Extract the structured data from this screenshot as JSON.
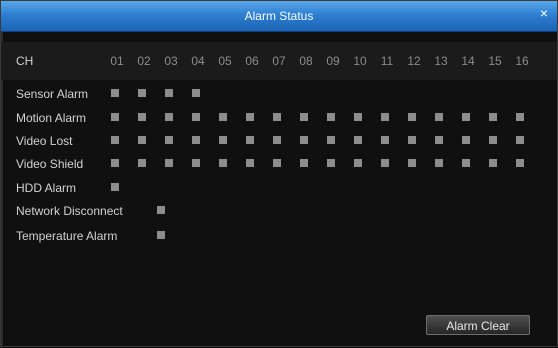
{
  "window": {
    "title": "Alarm Status",
    "close_glyph": "×"
  },
  "header": {
    "label": "CH",
    "channels": [
      "01",
      "02",
      "03",
      "04",
      "05",
      "06",
      "07",
      "08",
      "09",
      "10",
      "11",
      "12",
      "13",
      "14",
      "15",
      "16"
    ]
  },
  "rows": [
    {
      "label": "Sensor Alarm",
      "channels": 4
    },
    {
      "label": "Motion Alarm",
      "channels": 16
    },
    {
      "label": "Video Lost",
      "channels": 16
    },
    {
      "label": "Video Shield",
      "channels": 16
    },
    {
      "label": "HDD Alarm",
      "channels": 1
    },
    {
      "label": "Network Disconnect",
      "channels": 1
    },
    {
      "label": "Temperature Alarm",
      "channels": 1
    }
  ],
  "actions": {
    "clear_label": "Alarm Clear"
  },
  "colors": {
    "titlebar": "#2d7fd1",
    "indicator": "#8d8d8d",
    "background": "#101010"
  }
}
